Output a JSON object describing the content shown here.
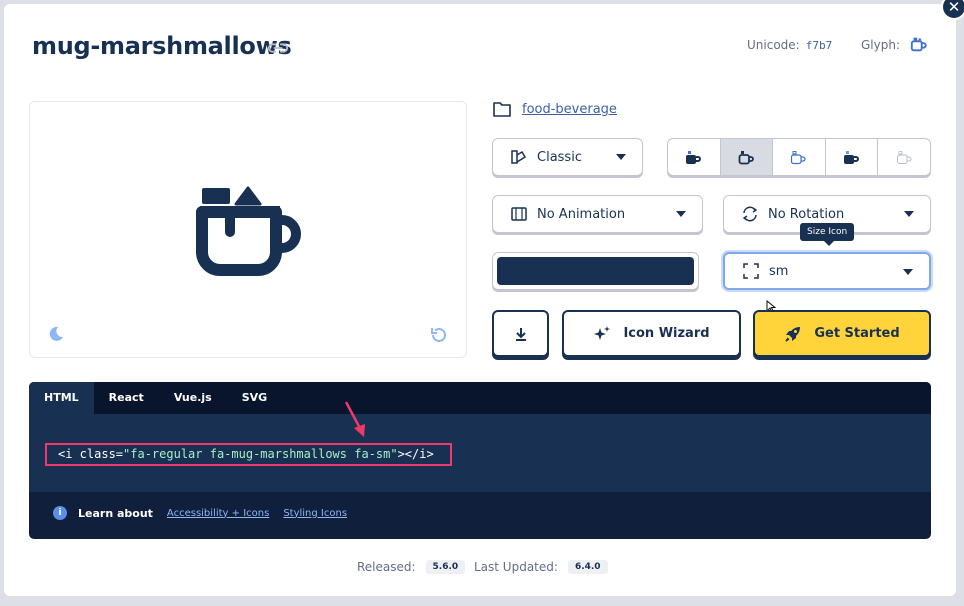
{
  "header": {
    "title": "mug-marshmallows",
    "unicode_label": "Unicode:",
    "unicode_value": "f7b7",
    "glyph_label": "Glyph:"
  },
  "category": {
    "label": "food-beverage"
  },
  "style_select": {
    "value": "Classic"
  },
  "animation_select": {
    "value": "No Animation"
  },
  "rotation_select": {
    "value": "No Rotation"
  },
  "size_select": {
    "value": "sm",
    "tooltip": "Size Icon"
  },
  "color": {
    "value": "#183153"
  },
  "actions": {
    "icon_wizard": "Icon Wizard",
    "get_started": "Get Started"
  },
  "code": {
    "tabs": [
      "HTML",
      "React",
      "Vue.js",
      "SVG"
    ],
    "snippet_open": "<i class=",
    "snippet_class": "\"fa-regular fa-mug-marshmallows fa-sm\"",
    "snippet_close": "></i>",
    "learn_label": "Learn about",
    "link_accessibility": "Accessibility + Icons",
    "link_styling": "Styling Icons"
  },
  "footer": {
    "released_label": "Released:",
    "released_version": "5.6.0",
    "updated_label": "Last Updated:",
    "updated_version": "6.4.0"
  },
  "colors": {
    "navy": "#183153",
    "accent": "#ffd43b",
    "link": "#3b5fa5",
    "highlight": "#f0396b"
  }
}
